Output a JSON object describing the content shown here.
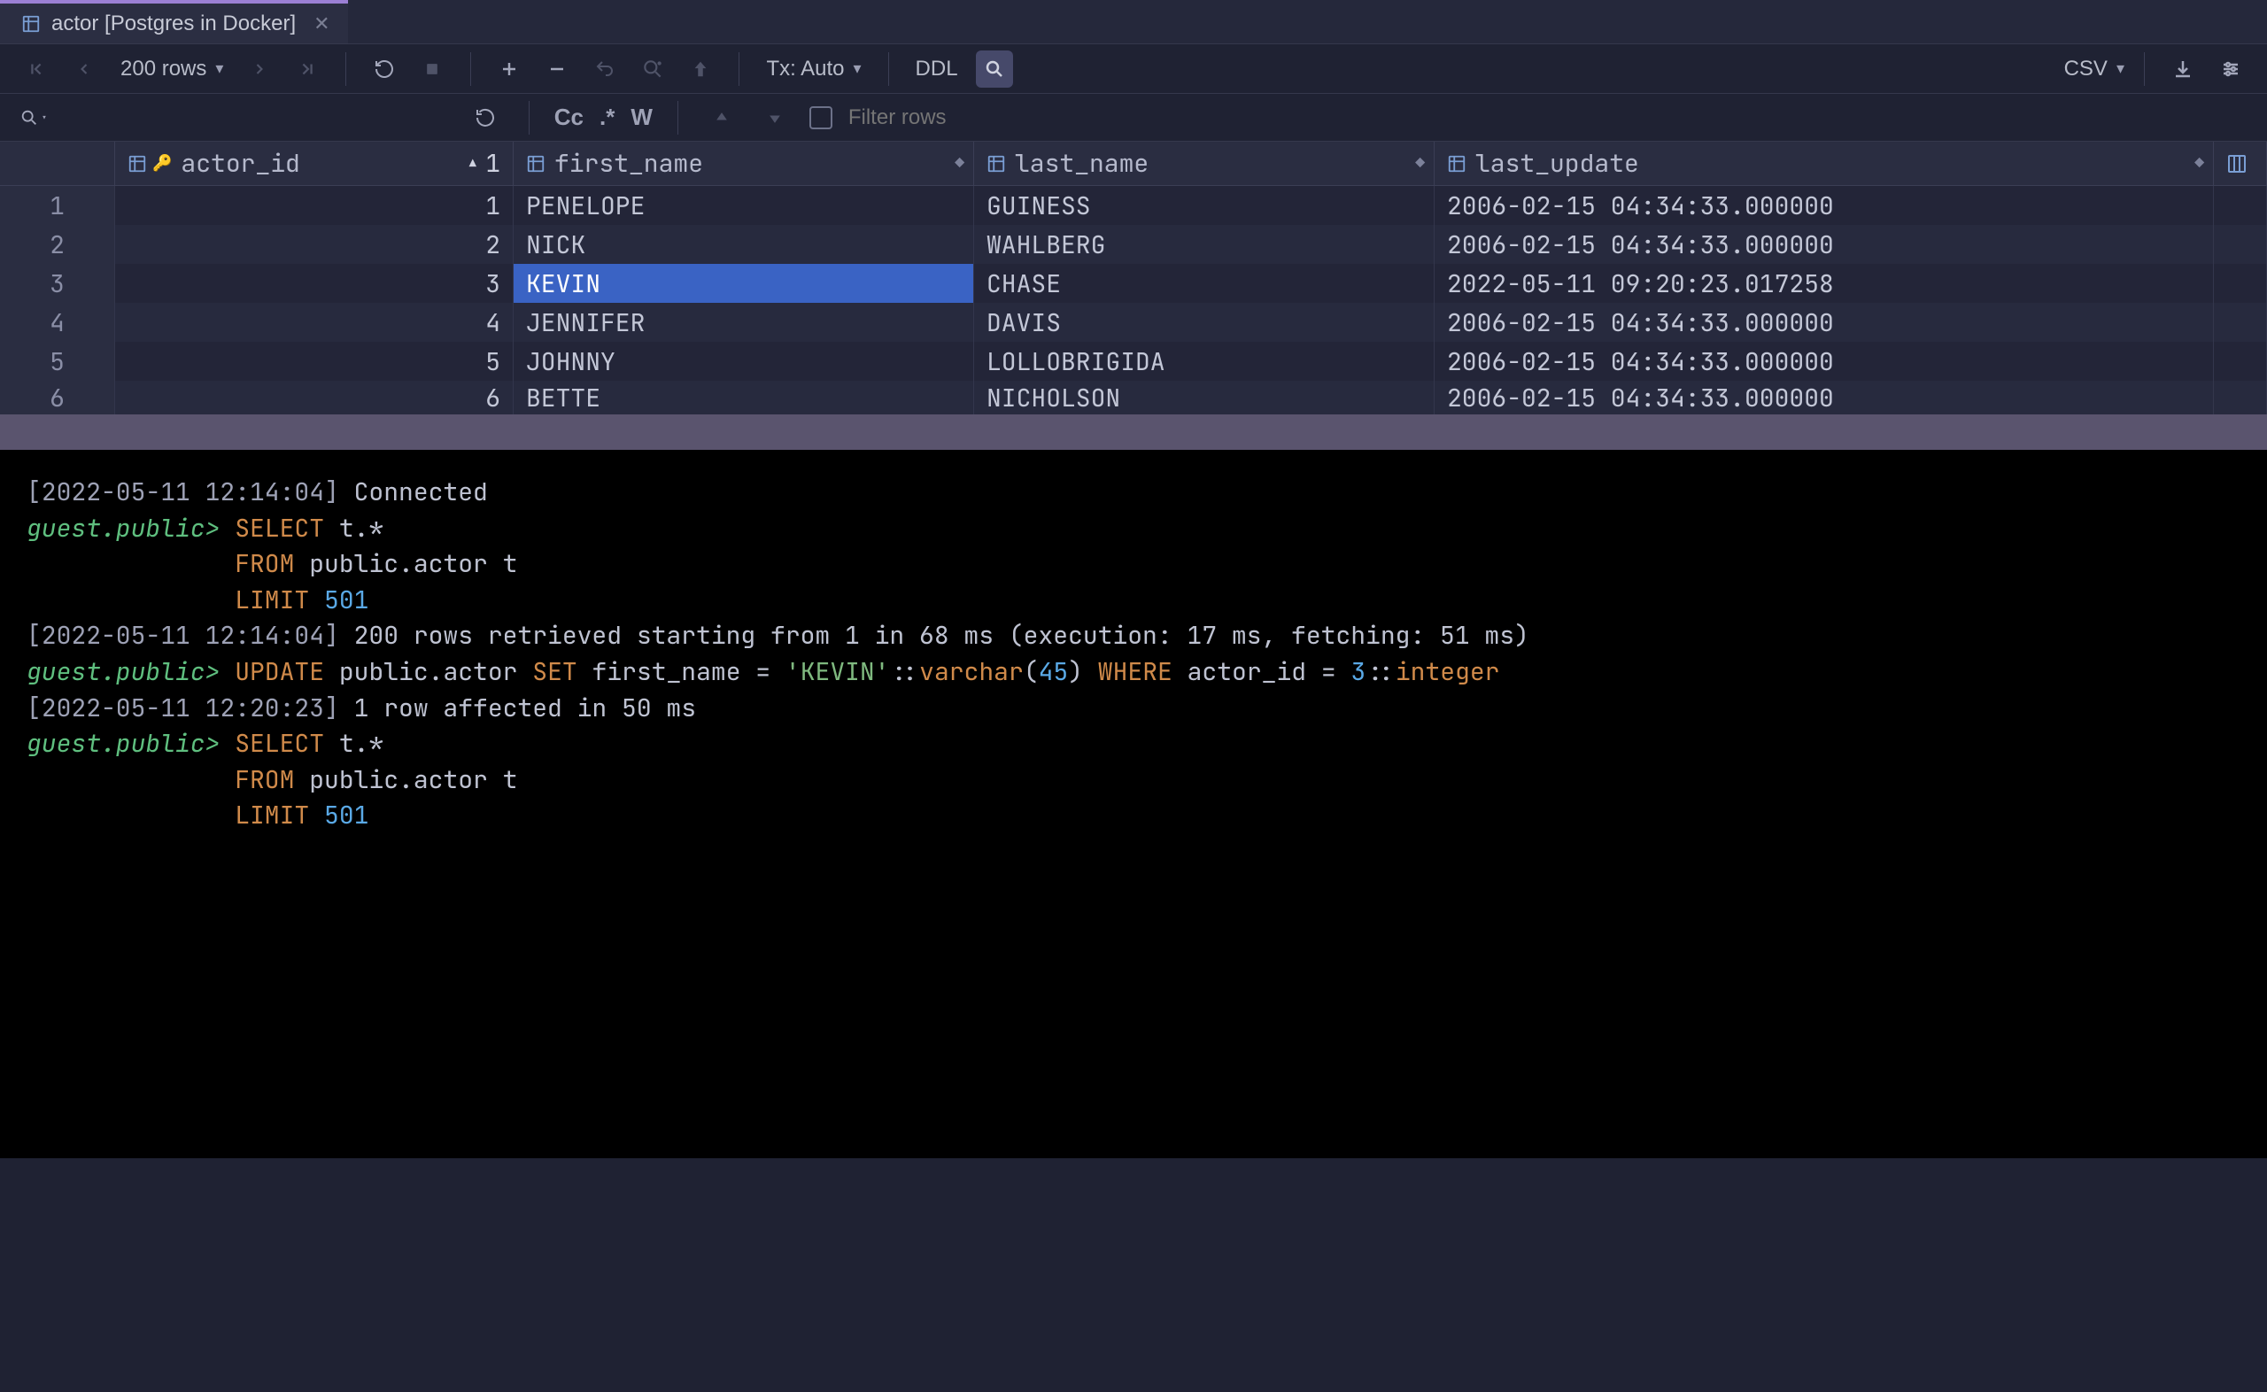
{
  "tab": {
    "title": "actor [Postgres in Docker]"
  },
  "toolbar": {
    "rows_label": "200 rows",
    "tx_label": "Tx: Auto",
    "ddl_label": "DDL",
    "export_label": "CSV"
  },
  "filter": {
    "placeholder": "Filter rows",
    "cc": "Cc",
    "star": ".*",
    "w": "W"
  },
  "columns": [
    {
      "name": "actor_id",
      "sorted": true,
      "sort_index": "1"
    },
    {
      "name": "first_name",
      "sorted": false
    },
    {
      "name": "last_name",
      "sorted": false
    },
    {
      "name": "last_update",
      "sorted": false
    }
  ],
  "rows": [
    {
      "n": "1",
      "actor_id": "1",
      "first_name": "PENELOPE",
      "last_name": "GUINESS",
      "last_update": "2006-02-15 04:34:33.000000"
    },
    {
      "n": "2",
      "actor_id": "2",
      "first_name": "NICK",
      "last_name": "WAHLBERG",
      "last_update": "2006-02-15 04:34:33.000000"
    },
    {
      "n": "3",
      "actor_id": "3",
      "first_name": "KEVIN",
      "last_name": "CHASE",
      "last_update": "2022-05-11 09:20:23.017258",
      "selected_col": "first_name"
    },
    {
      "n": "4",
      "actor_id": "4",
      "first_name": "JENNIFER",
      "last_name": "DAVIS",
      "last_update": "2006-02-15 04:34:33.000000"
    },
    {
      "n": "5",
      "actor_id": "5",
      "first_name": "JOHNNY",
      "last_name": "LOLLOBRIGIDA",
      "last_update": "2006-02-15 04:34:33.000000"
    },
    {
      "n": "6",
      "actor_id": "6",
      "first_name": "BETTE",
      "last_name": "NICHOLSON",
      "last_update": "2006-02-15 04:34:33.000000"
    }
  ],
  "console": {
    "l1_ts": "[2022-05-11 12:14:04]",
    "l1_msg": "Connected",
    "prompt": "guest.public>",
    "sel_select": "SELECT",
    "sel_tstar": "t.*",
    "sel_from": "FROM",
    "sel_public": "public",
    "sel_dot_actor": ".actor t",
    "sel_limit": "LIMIT",
    "sel_501": "501",
    "l4_ts": "[2022-05-11 12:14:04]",
    "l4_msg": "200 rows retrieved starting from 1 in 68 ms (execution: 17 ms, fetching: 51 ms)",
    "upd_update": "UPDATE",
    "upd_public": "public",
    "upd_dot_actor": ".actor",
    "upd_set": "SET",
    "upd_col": "first_name =",
    "upd_val": "'KEVIN'",
    "upd_cast1": "::",
    "upd_varchar": "varchar",
    "upd_paren_open": "(",
    "upd_45": "45",
    "upd_paren_close": ")",
    "upd_where": "WHERE",
    "upd_where_col": "actor_id =",
    "upd_3": "3",
    "upd_cast2": "::",
    "upd_integer": "integer",
    "l6_ts": "[2022-05-11 12:20:23]",
    "l6_msg": "1 row affected in 50 ms"
  }
}
